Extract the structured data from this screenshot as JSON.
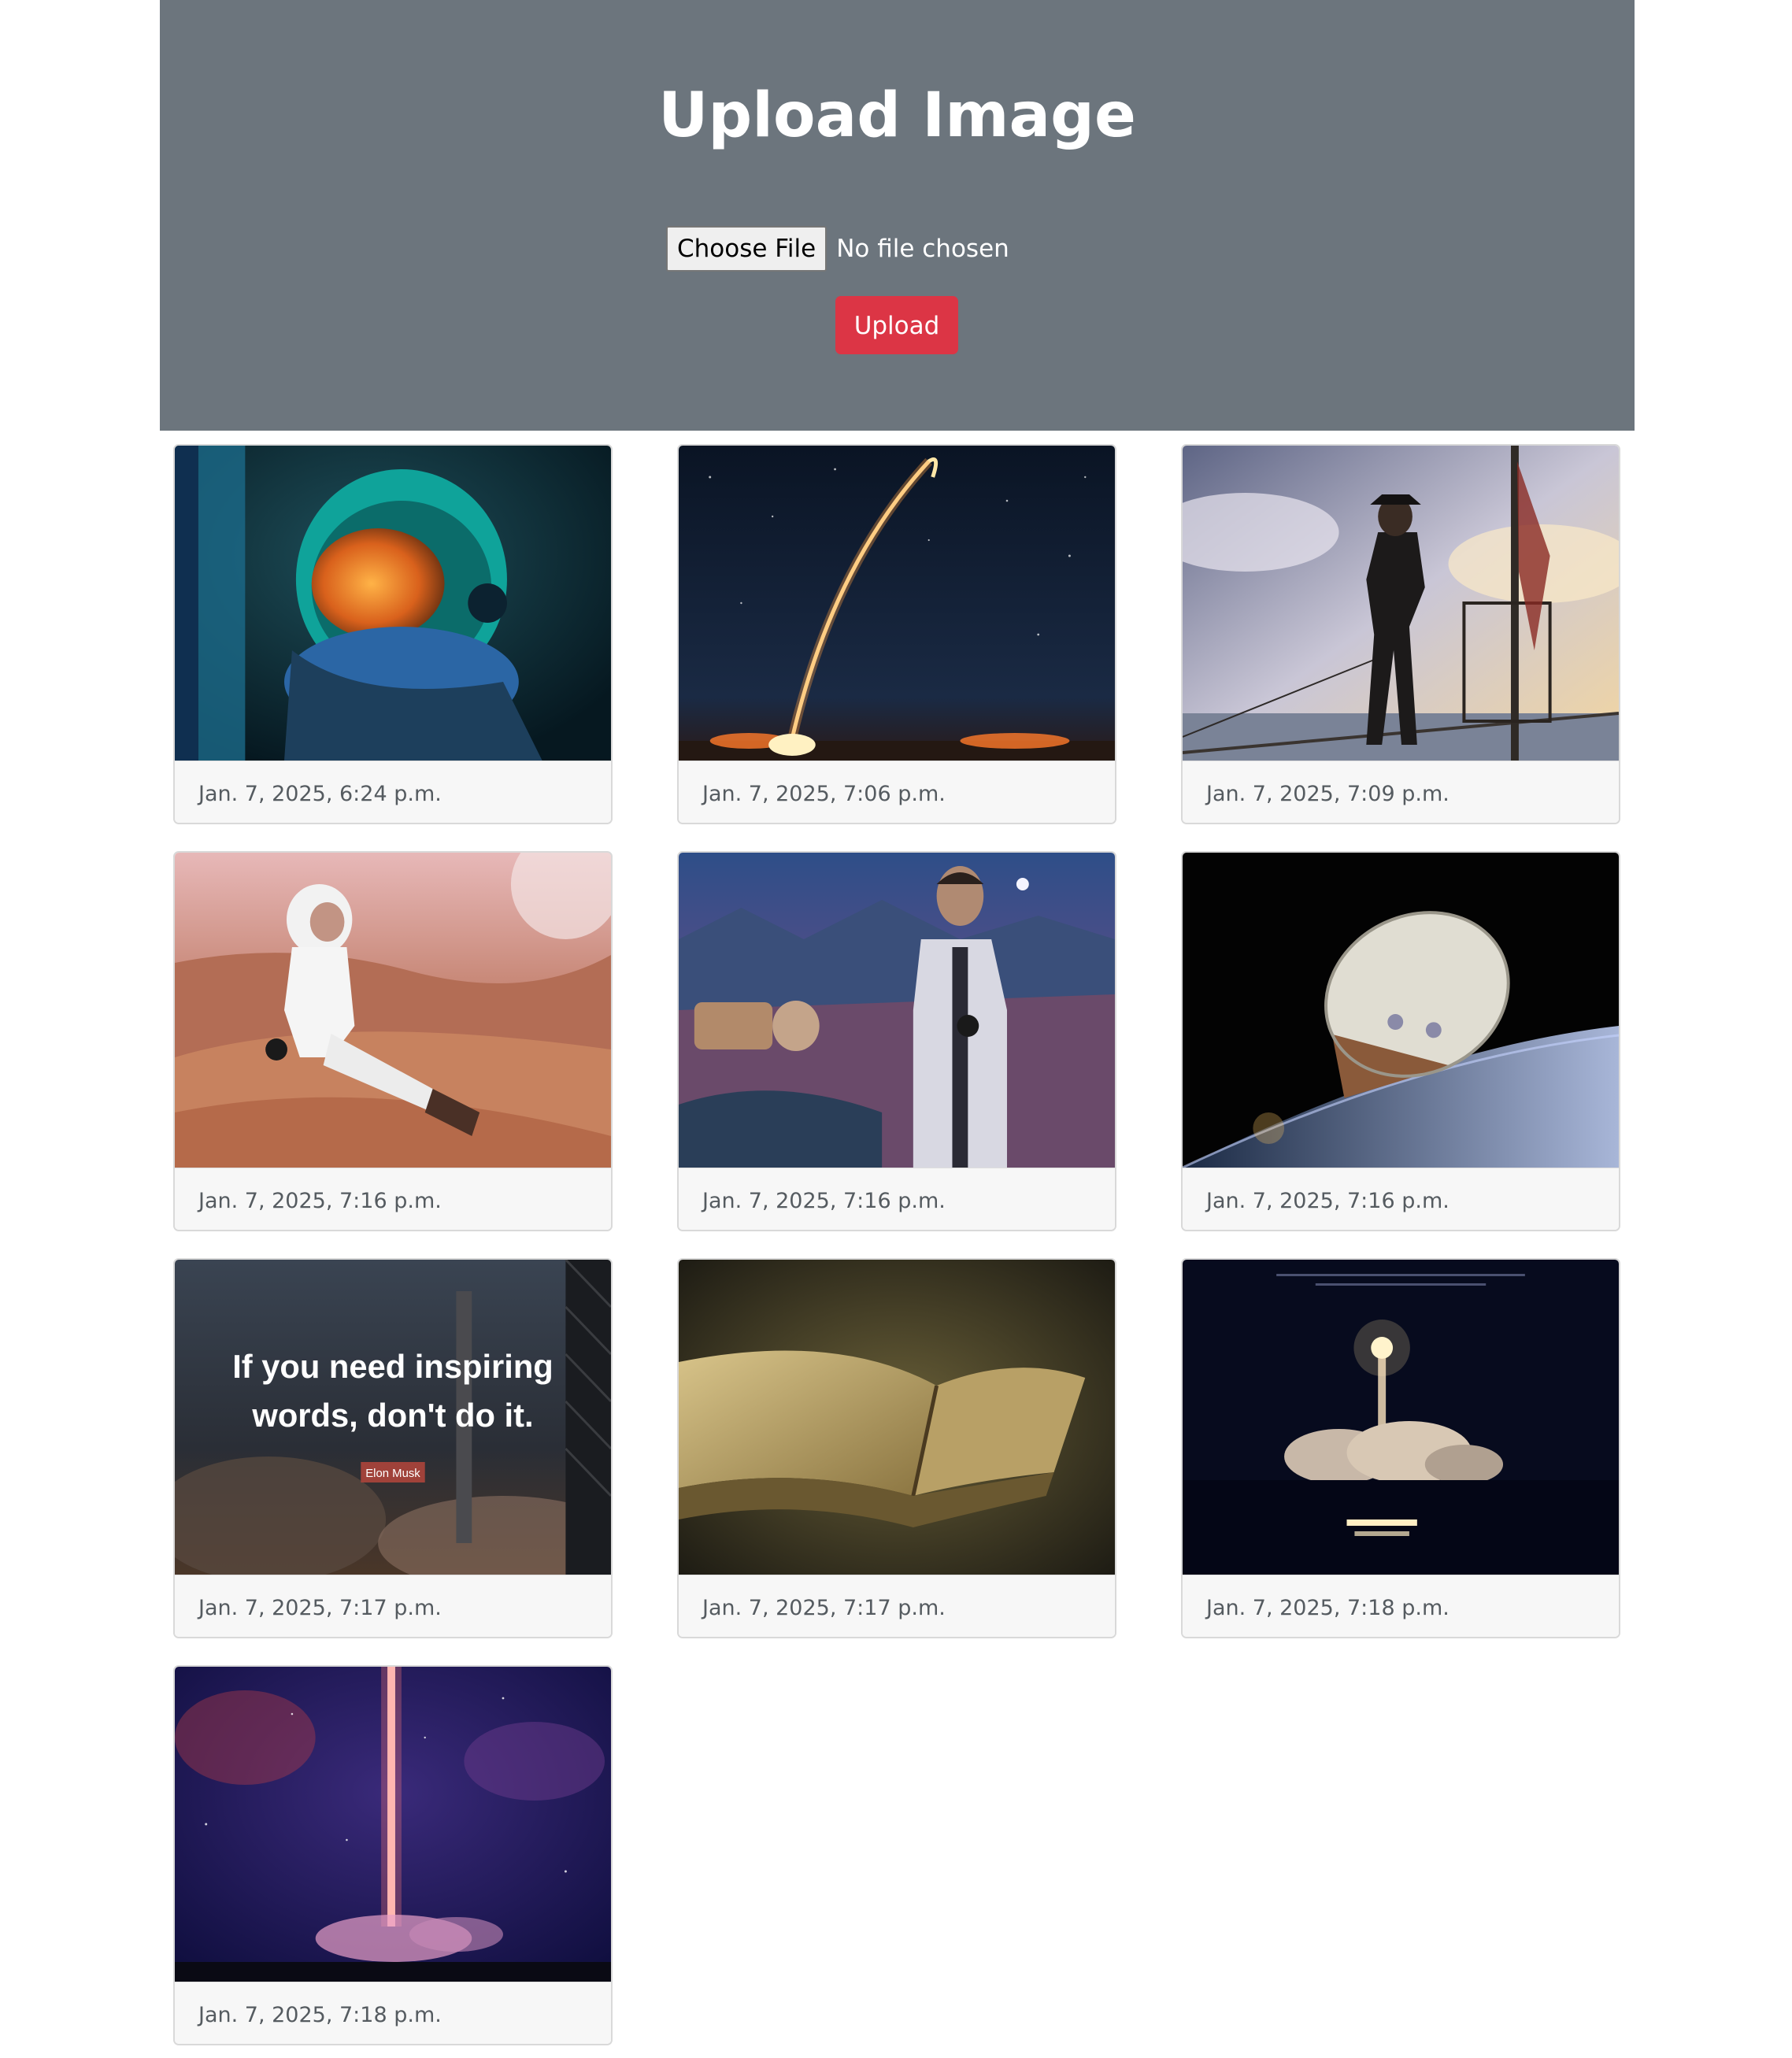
{
  "header": {
    "title": "Upload Image",
    "file_button_label": "Choose File",
    "file_status": "No file chosen",
    "upload_label": "Upload"
  },
  "colors": {
    "hero_bg": "#6c757d",
    "upload_btn": "#dc3545"
  },
  "gallery": [
    {
      "timestamp": "Jan. 7, 2025, 6:24 p.m.",
      "image": "astronaut-helmet-portrait"
    },
    {
      "timestamp": "Jan. 7, 2025, 7:06 p.m.",
      "image": "rocket-launch-night-trail"
    },
    {
      "timestamp": "Jan. 7, 2025, 7:09 p.m.",
      "image": "pirate-on-ship-mast"
    },
    {
      "timestamp": "Jan. 7, 2025, 7:16 p.m.",
      "image": "astronaut-sitting-on-dune"
    },
    {
      "timestamp": "Jan. 7, 2025, 7:16 p.m.",
      "image": "man-in-spacesuit-on-mars"
    },
    {
      "timestamp": "Jan. 7, 2025, 7:16 p.m.",
      "image": "capsule-over-earth"
    },
    {
      "timestamp": "Jan. 7, 2025, 7:17 p.m.",
      "image": "quote-poster-rocket",
      "caption_lines": [
        "If you need inspiring",
        "words, don't do it."
      ],
      "caption_author": "Elon Musk"
    },
    {
      "timestamp": "Jan. 7, 2025, 7:17 p.m.",
      "image": "open-old-book"
    },
    {
      "timestamp": "Jan. 7, 2025, 7:18 p.m.",
      "image": "rocket-launch-reflection"
    },
    {
      "timestamp": "Jan. 7, 2025, 7:18 p.m.",
      "image": "rocket-launch-galaxy"
    }
  ]
}
